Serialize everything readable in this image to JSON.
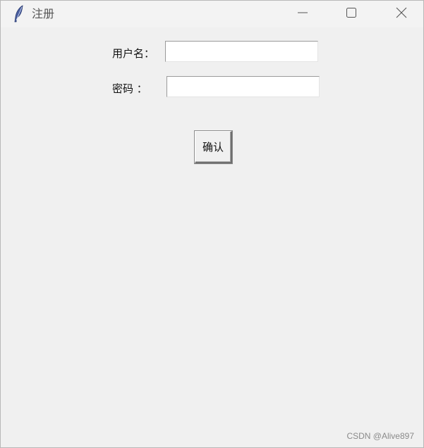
{
  "window": {
    "title": "注册",
    "icon": "feather-icon"
  },
  "controls": {
    "minimize": "minimize-icon",
    "maximize": "maximize-icon",
    "close": "close-icon"
  },
  "form": {
    "username_label": "用户名：",
    "username_value": "",
    "password_label": "密码 ：",
    "password_value": "",
    "confirm_label": "确认"
  },
  "watermark": "CSDN @Alive897"
}
